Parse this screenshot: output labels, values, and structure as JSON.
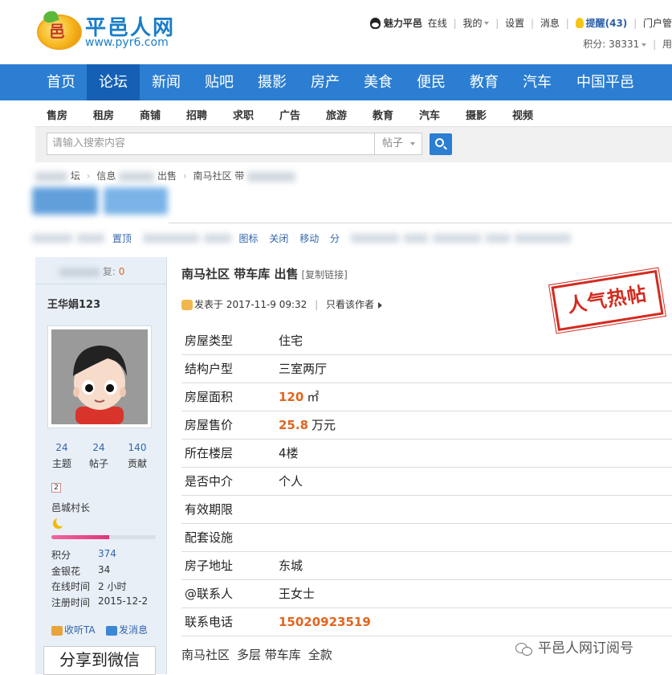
{
  "logo": {
    "name": "平邑人网",
    "url": "www.pyr6.com",
    "char": "邑"
  },
  "userbar": {
    "user": "魅力平邑",
    "status": "在线",
    "mine": "我的",
    "settings": "设置",
    "messages": "消息",
    "reminder": "提醒(43)",
    "portal": "门户管",
    "points": "积分: 38331",
    "user_short": "用"
  },
  "nav": {
    "items": [
      "首页",
      "论坛",
      "新闻",
      "贴吧",
      "摄影",
      "房产",
      "美食",
      "便民",
      "教育",
      "汽车",
      "中国平邑"
    ],
    "active": "论坛"
  },
  "subnav": {
    "items": [
      "售房",
      "租房",
      "商铺",
      "招聘",
      "求职",
      "广告",
      "旅游",
      "教育",
      "汽车",
      "摄影",
      "视频"
    ]
  },
  "search": {
    "placeholder": "请输入搜索内容",
    "type": "帖子"
  },
  "breadcrumb": {
    "forum": "坛",
    "info": "信息",
    "sale": "出售",
    "current": "南马社区 带"
  },
  "toolbar": {
    "top": "置顶",
    "icon": "图标",
    "close": "关闭",
    "move": "移动",
    "split": "分"
  },
  "sidebar": {
    "reply_label": "复:",
    "reply_count": "0",
    "username": "王华娟123",
    "stats": [
      {
        "value": "24",
        "label": "主题"
      },
      {
        "value": "24",
        "label": "帖子"
      },
      {
        "value": "140",
        "label": "贡献"
      }
    ],
    "level": "2",
    "rank": "邑城村长",
    "progress": 0.55,
    "info": [
      {
        "key": "积分",
        "value": "374"
      },
      {
        "key": "金银花",
        "value": "34"
      },
      {
        "key": "在线时间",
        "value": "2 小时"
      },
      {
        "key": "注册时间",
        "value": "2015-12-2"
      }
    ],
    "listen": "收听TA",
    "message": "发消息",
    "share": "分享到微信"
  },
  "post": {
    "title": "南马社区 带车库 出售",
    "copy_link": "[复制链接]",
    "posted": "发表于 2017-11-9 09:32",
    "only_author": "只看该作者",
    "stamp": "人气热帖",
    "props": [
      {
        "key": "房屋类型",
        "value": "住宅"
      },
      {
        "key": "结构户型",
        "value": "三室两厅"
      },
      {
        "key": "房屋面积",
        "value": "120",
        "unit": "㎡",
        "highlight": true
      },
      {
        "key": "房屋售价",
        "value": "25.8",
        "unit": "万元",
        "highlight": true
      },
      {
        "key": "所在楼层",
        "value": "4楼"
      },
      {
        "key": "是否中介",
        "value": "个人"
      },
      {
        "key": "有效期限",
        "value": ""
      },
      {
        "key": "配套设施",
        "value": ""
      },
      {
        "key": "房子地址",
        "value": "东城"
      },
      {
        "key": "@联系人",
        "value": "王女士"
      },
      {
        "key": "联系电话",
        "value": "15020923519",
        "highlight": true
      }
    ],
    "footer": [
      "南马社区",
      "多层 带车库",
      "全款"
    ]
  },
  "watermark": "平邑人网订阅号",
  "colors": {
    "brand_blue": "#2b7ed1",
    "nav_active": "#1560b4",
    "highlight": "#e0651f",
    "stamp": "#d32a1f"
  }
}
